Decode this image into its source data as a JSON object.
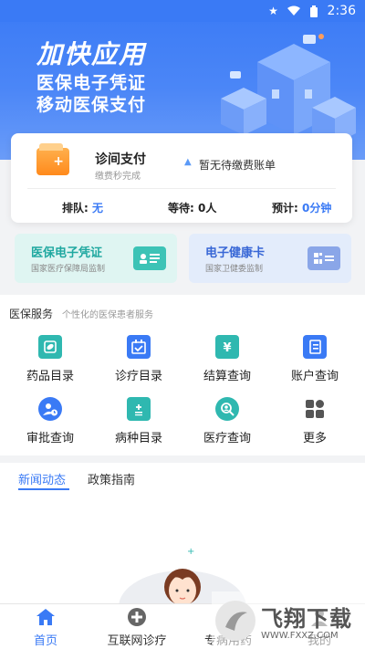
{
  "status": {
    "time": "2:36"
  },
  "banner": {
    "title": "加快应用",
    "line1": "医保电子凭证",
    "line2": "移动医保支付"
  },
  "payment": {
    "title": "诊间支付",
    "subtitle": "缴费秒完成",
    "bill_status": "暂无待缴费账单",
    "queue_label": "排队:",
    "queue_value": "无",
    "wait_label": "等待:",
    "wait_value": "0人",
    "estimate_label": "预计:",
    "estimate_value": "0分钟"
  },
  "certs": [
    {
      "title": "医保电子凭证",
      "subtitle": "国家医疗保障局监制",
      "color": "#20a8a0"
    },
    {
      "title": "电子健康卡",
      "subtitle": "国家卫健委监制",
      "color": "#3867d6"
    }
  ],
  "services": {
    "title": "医保服务",
    "subtitle": "个性化的医保患者服务",
    "items": [
      {
        "label": "药品目录",
        "icon": "medicine-icon",
        "color": "#2fb8b0"
      },
      {
        "label": "诊疗目录",
        "icon": "calendar-check-icon",
        "color": "#3a7af5"
      },
      {
        "label": "结算查询",
        "icon": "yen-money-icon",
        "color": "#2fb8b0"
      },
      {
        "label": "账户查询",
        "icon": "account-book-icon",
        "color": "#3a7af5"
      },
      {
        "label": "审批查询",
        "icon": "user-clock-icon",
        "color": "#3a7af5"
      },
      {
        "label": "病种目录",
        "icon": "document-plus-icon",
        "color": "#2fb8b0"
      },
      {
        "label": "医疗查询",
        "icon": "search-user-icon",
        "color": "#2fb8b0"
      },
      {
        "label": "更多",
        "icon": "more-grid-icon",
        "color": "#555555"
      }
    ]
  },
  "news": {
    "tabs": [
      "新闻动态",
      "政策指南"
    ],
    "active_tab": 0
  },
  "bottom_nav": {
    "items": [
      {
        "label": "首页",
        "icon": "home-icon"
      },
      {
        "label": "互联网诊疗",
        "icon": "plus-circle-icon"
      },
      {
        "label": "专病用药",
        "icon": "pill-icon"
      },
      {
        "label": "我的",
        "icon": "user-icon"
      }
    ],
    "active": 0
  },
  "watermark": {
    "brand": "飞翔下载",
    "url": "WWW.FXXZ.COM"
  },
  "colors": {
    "primary": "#3a7af5",
    "teal": "#20a8a0",
    "orange": "#ff9a2e"
  }
}
